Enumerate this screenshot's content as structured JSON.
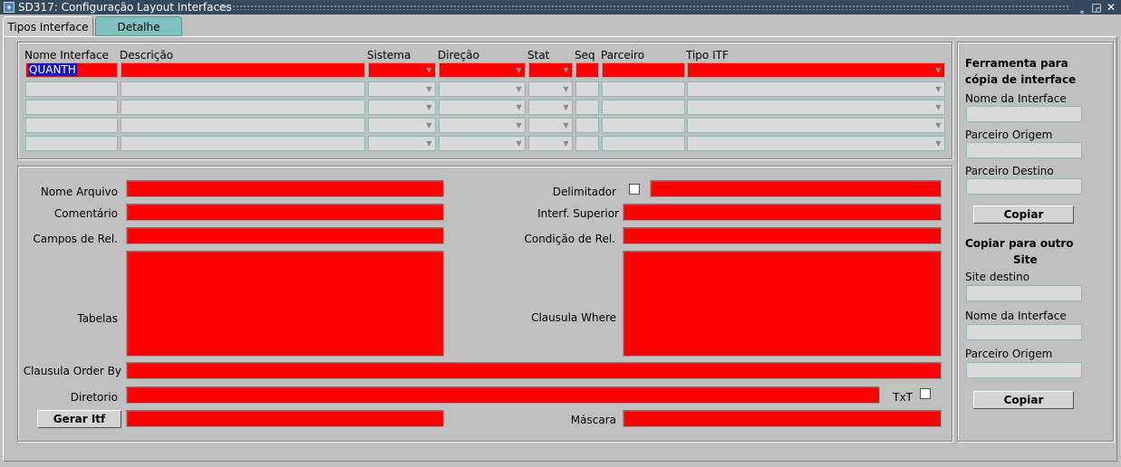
{
  "window": {
    "title": "SD317: Configuração Layout Interfaces",
    "app_icon": "oracle-forms-icon",
    "controls": [
      "minimize-icon",
      "maximize-icon",
      "close-icon"
    ],
    "minimize": "˳",
    "restore": "◲",
    "close": "✕"
  },
  "tabs": [
    {
      "label": "Tipos Interface",
      "active": true
    },
    {
      "label": "Detalhe",
      "active": false
    }
  ],
  "grid": {
    "headers": {
      "nome": "Nome Interface",
      "descricao": "Descrição",
      "sistema": "Sistema",
      "direcao": "Direção",
      "stat": "Stat",
      "seq": "Seq",
      "parceiro": "Parceiro",
      "tipo": "Tipo ITF"
    },
    "rows": [
      {
        "nome": "QUANTH",
        "descricao": "",
        "sistema": "",
        "direcao": "",
        "stat": "",
        "seq": "",
        "parceiro": "",
        "tipo": ""
      },
      {
        "nome": "",
        "descricao": "",
        "sistema": "",
        "direcao": "",
        "stat": "",
        "seq": "",
        "parceiro": "",
        "tipo": ""
      },
      {
        "nome": "",
        "descricao": "",
        "sistema": "",
        "direcao": "",
        "stat": "",
        "seq": "",
        "parceiro": "",
        "tipo": ""
      },
      {
        "nome": "",
        "descricao": "",
        "sistema": "",
        "direcao": "",
        "stat": "",
        "seq": "",
        "parceiro": "",
        "tipo": ""
      },
      {
        "nome": "",
        "descricao": "",
        "sistema": "",
        "direcao": "",
        "stat": "",
        "seq": "",
        "parceiro": "",
        "tipo": ""
      }
    ]
  },
  "form": {
    "nome_arquivo": {
      "label": "Nome Arquivo",
      "value": ""
    },
    "comentario": {
      "label": "Comentário",
      "value": ""
    },
    "campos_rel": {
      "label": "Campos de Rel.",
      "value": ""
    },
    "tabelas": {
      "label": "Tabelas",
      "value": ""
    },
    "order_by": {
      "label": "Clausula Order By",
      "value": ""
    },
    "diretorio": {
      "label": "Diretorio",
      "value": ""
    },
    "gerar_itf": {
      "label": "Gerar Itf",
      "value": ""
    },
    "delimitador": {
      "label": "Delimitador",
      "checked": false,
      "value": ""
    },
    "interf_superior": {
      "label": "Interf. Superior",
      "value": ""
    },
    "condicao_rel": {
      "label": "Condição de Rel.",
      "value": ""
    },
    "clausula_where": {
      "label": "Clausula Where",
      "value": ""
    },
    "txt": {
      "label": "TxT",
      "checked": false
    },
    "mascara": {
      "label": "Máscara",
      "value": ""
    }
  },
  "copy_tool": {
    "title_line1": "Ferramenta para",
    "title_line2": "cópia de interface",
    "nome_interface_label": "Nome da Interface",
    "parceiro_origem_label": "Parceiro Origem",
    "parceiro_destino_label": "Parceiro Destino",
    "button": "Copiar"
  },
  "copy_site": {
    "title_line1": "Copiar para outro",
    "title_line2": "Site",
    "site_destino_label": "Site destino",
    "nome_interface_label": "Nome da Interface",
    "parceiro_origem_label": "Parceiro Origem",
    "button": "Copiar"
  },
  "colors": {
    "required_field": "#ff0000",
    "titlebar": "#34495e",
    "inactive_tab": "#7ec1bd",
    "selection": "#1515c6",
    "background": "#c0c0c0"
  }
}
